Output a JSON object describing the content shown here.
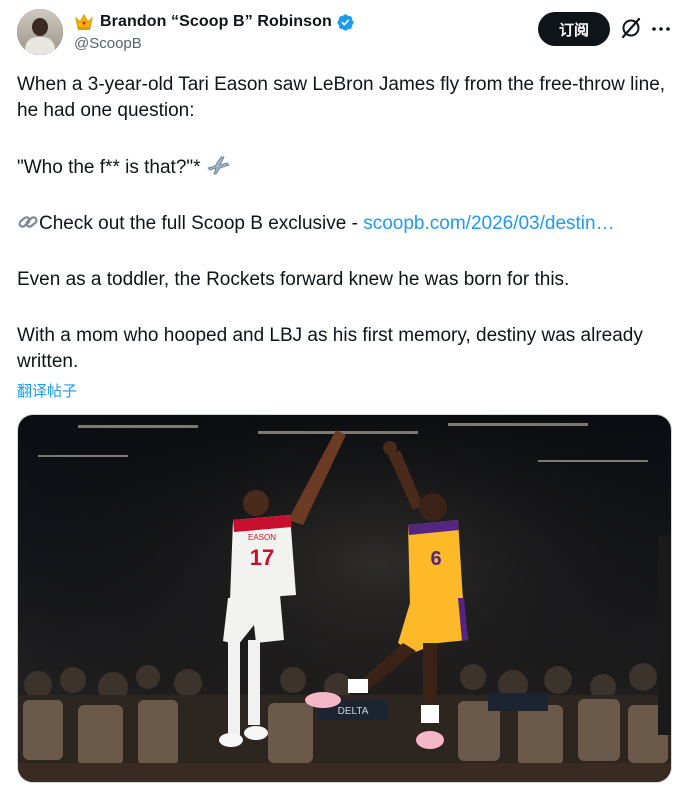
{
  "author": {
    "display_name": "Brandon “Scoop B” Robinson",
    "handle": "@ScoopB"
  },
  "actions": {
    "follow_label": "订阅"
  },
  "tweet": {
    "line1": "When a 3-year-old Tari Eason saw LeBron James fly from the free-throw line, he had one question:",
    "quote": "\"Who the f** is that?\"*",
    "link_prefix": "Check out the full Scoop B exclusive -",
    "link_text": "scoopb.com/2026/03/destin…",
    "para3": "Even as a toddler, the Rockets forward knew he was born for this.",
    "para4": "With a mom who hooped and LBJ as his first memory, destiny was already written."
  },
  "translate_label": "翻译帖子",
  "media": {
    "jersey_left_name": "EASON",
    "jersey_left_number": "17",
    "jersey_right_number": "6",
    "sign_text": "DELTA"
  },
  "icons": {
    "crown": "crown-emoji",
    "verified": "verified-badge-icon",
    "grok": "grok-icon",
    "more": "more-icon",
    "airplane": "airplane-emoji",
    "link": "link-emoji"
  },
  "colors": {
    "accent": "#1d9bf0",
    "button_bg": "#0f1419",
    "text": "#0f1419",
    "muted": "#536471"
  }
}
